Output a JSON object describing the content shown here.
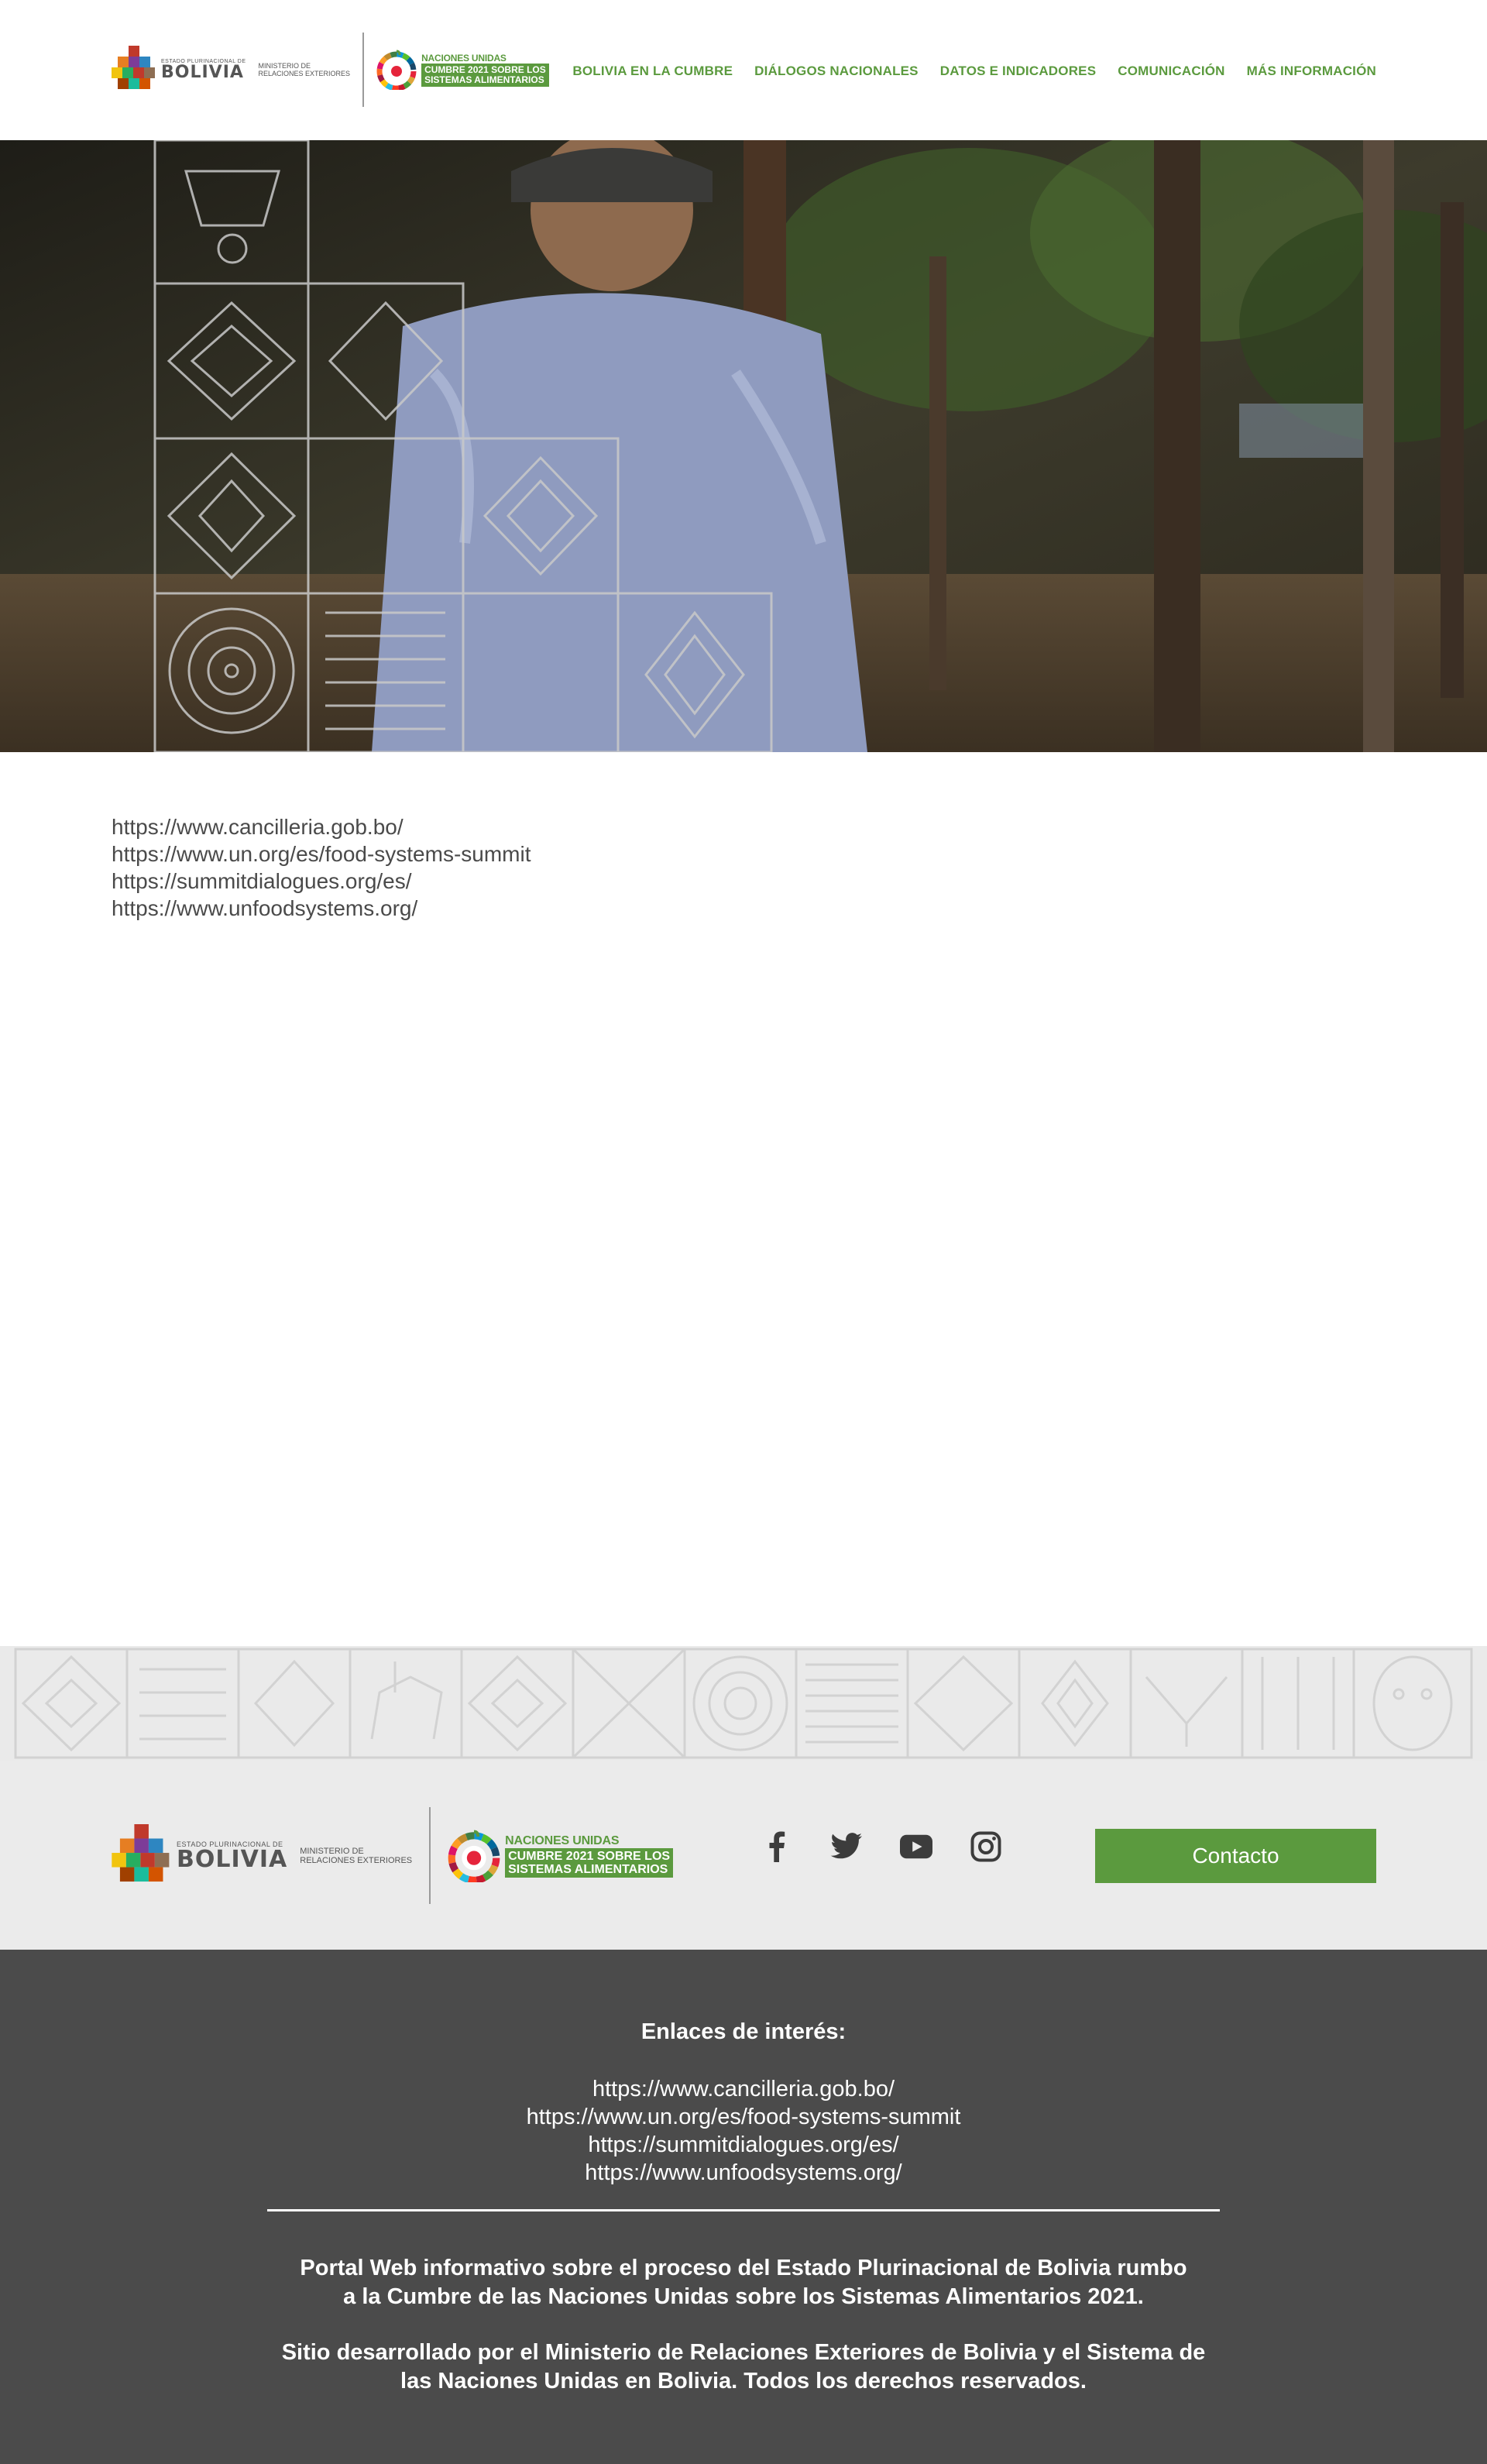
{
  "header": {
    "bolivia_logo": {
      "small": "Estado Plurinacional de",
      "big": "BOLIVIA"
    },
    "ministry": {
      "line1": "Ministerio de",
      "line2": "Relaciones Exteriores"
    },
    "un_logo": {
      "small": "NACIONES UNIDAS",
      "line1": "CUMBRE 2021 SOBRE LOS",
      "line2": "SISTEMAS ALIMENTARIOS"
    }
  },
  "nav": {
    "items": [
      {
        "label": "BOLIVIA EN LA CUMBRE"
      },
      {
        "label": "DIÁLOGOS NACIONALES"
      },
      {
        "label": "DATOS E INDICADORES"
      },
      {
        "label": "COMUNICACIÓN"
      },
      {
        "label": "MÁS INFORMACIÓN"
      }
    ],
    "color": "#5b9a3e"
  },
  "content": {
    "links": [
      "https://www.cancilleria.gob.bo/",
      "https://www.un.org/es/food-systems-summit",
      "https://summitdialogues.org/es/",
      "https://www.unfoodsystems.org/"
    ]
  },
  "footer": {
    "social": [
      "facebook-icon",
      "twitter-icon",
      "youtube-icon",
      "instagram-icon"
    ],
    "contact_label": "Contacto",
    "links_title": "Enlaces de interés:",
    "links": [
      "https://www.cancilleria.gob.bo/",
      "https://www.un.org/es/food-systems-summit",
      "https://summitdialogues.org/es/",
      "https://www.unfoodsystems.org/"
    ],
    "description_line1": "Portal Web informativo sobre el proceso del Estado Plurinacional de Bolivia rumbo",
    "description_line2": "a la Cumbre de las Naciones Unidas sobre los Sistemas Alimentarios 2021.",
    "credit_line1": "Sitio desarrollado por el Ministerio de Relaciones Exteriores de Bolivia y el Sistema de",
    "credit_line2": "las Naciones Unidas en Bolivia. Todos los derechos reservados."
  },
  "colors": {
    "brand_green": "#5b9a3e",
    "footer_dark": "#4b4b4b",
    "footer_light": "#ebebeb"
  }
}
